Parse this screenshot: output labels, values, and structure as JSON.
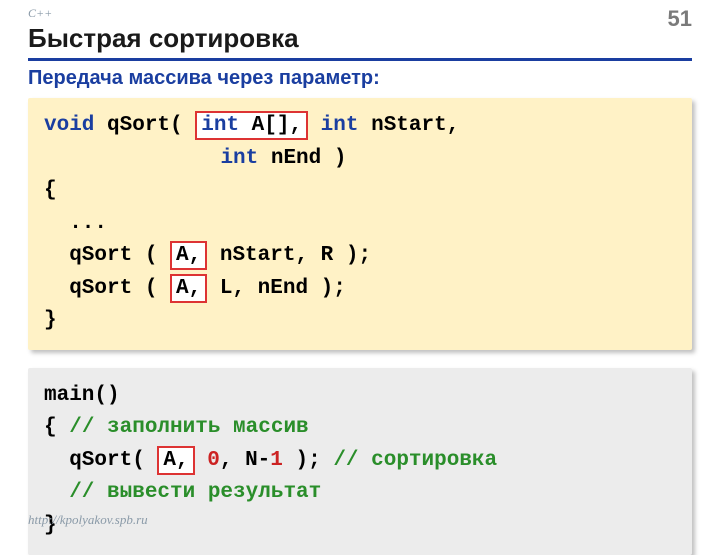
{
  "header": {
    "lang": "C++",
    "page_num": "51",
    "title": "Быстрая сортировка",
    "subtitle": "Передача массива через параметр:"
  },
  "code1": {
    "void": "void",
    "qsort_decl": " qSort( ",
    "param_hl": "int A[],",
    "int1": " int",
    "nstart": " nStart,",
    "pad": "              ",
    "int2": "int",
    "nend": " nEnd )",
    "open": "{",
    "dots": "  ...",
    "call1a": "  qSort ( ",
    "A1": "A,",
    "call1b": " nStart, R );",
    "call2a": "  qSort ( ",
    "A2": "A,",
    "call2b": " L, nEnd );",
    "close": "}"
  },
  "code2": {
    "main": "main()",
    "open": "{ ",
    "c_fill": "// заполнить массив",
    "call_a": "  qSort( ",
    "A": "A,",
    "sp": " ",
    "zero": "0",
    "com": ", N-",
    "one": "1",
    "rest": " ); ",
    "c_sort": "// сортировка",
    "c_out": "  // вывести результат",
    "close": "}"
  },
  "footer": {
    "url": "http://kpolyakov.spb.ru"
  }
}
